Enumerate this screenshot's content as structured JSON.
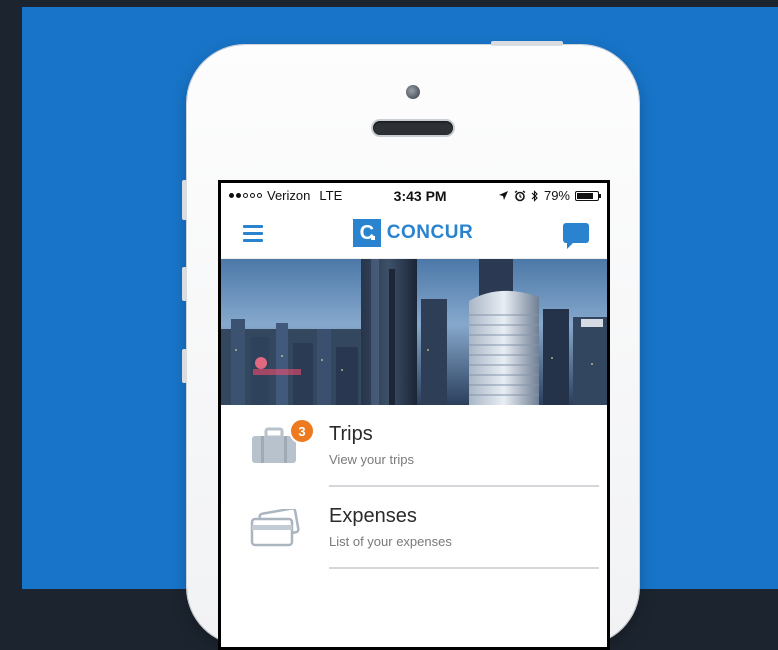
{
  "status_bar": {
    "carrier": "Verizon",
    "network": "LTE",
    "time": "3:43 PM",
    "battery": "79%",
    "battery_level": 0.79,
    "signal_bars_filled": 2,
    "signal_bars_total": 5
  },
  "nav": {
    "logo_text": "CONCUR",
    "logo_mark": "C"
  },
  "menu": {
    "items": [
      {
        "title": "Trips",
        "subtitle": "View your trips",
        "icon": "suitcase-icon",
        "badge": "3"
      },
      {
        "title": "Expenses",
        "subtitle": "List of your expenses",
        "icon": "credit-card-icon"
      }
    ]
  },
  "colors": {
    "background_blue": "#1874c8",
    "brand_blue": "#2a83cf",
    "badge_orange": "#ee7a1f"
  }
}
